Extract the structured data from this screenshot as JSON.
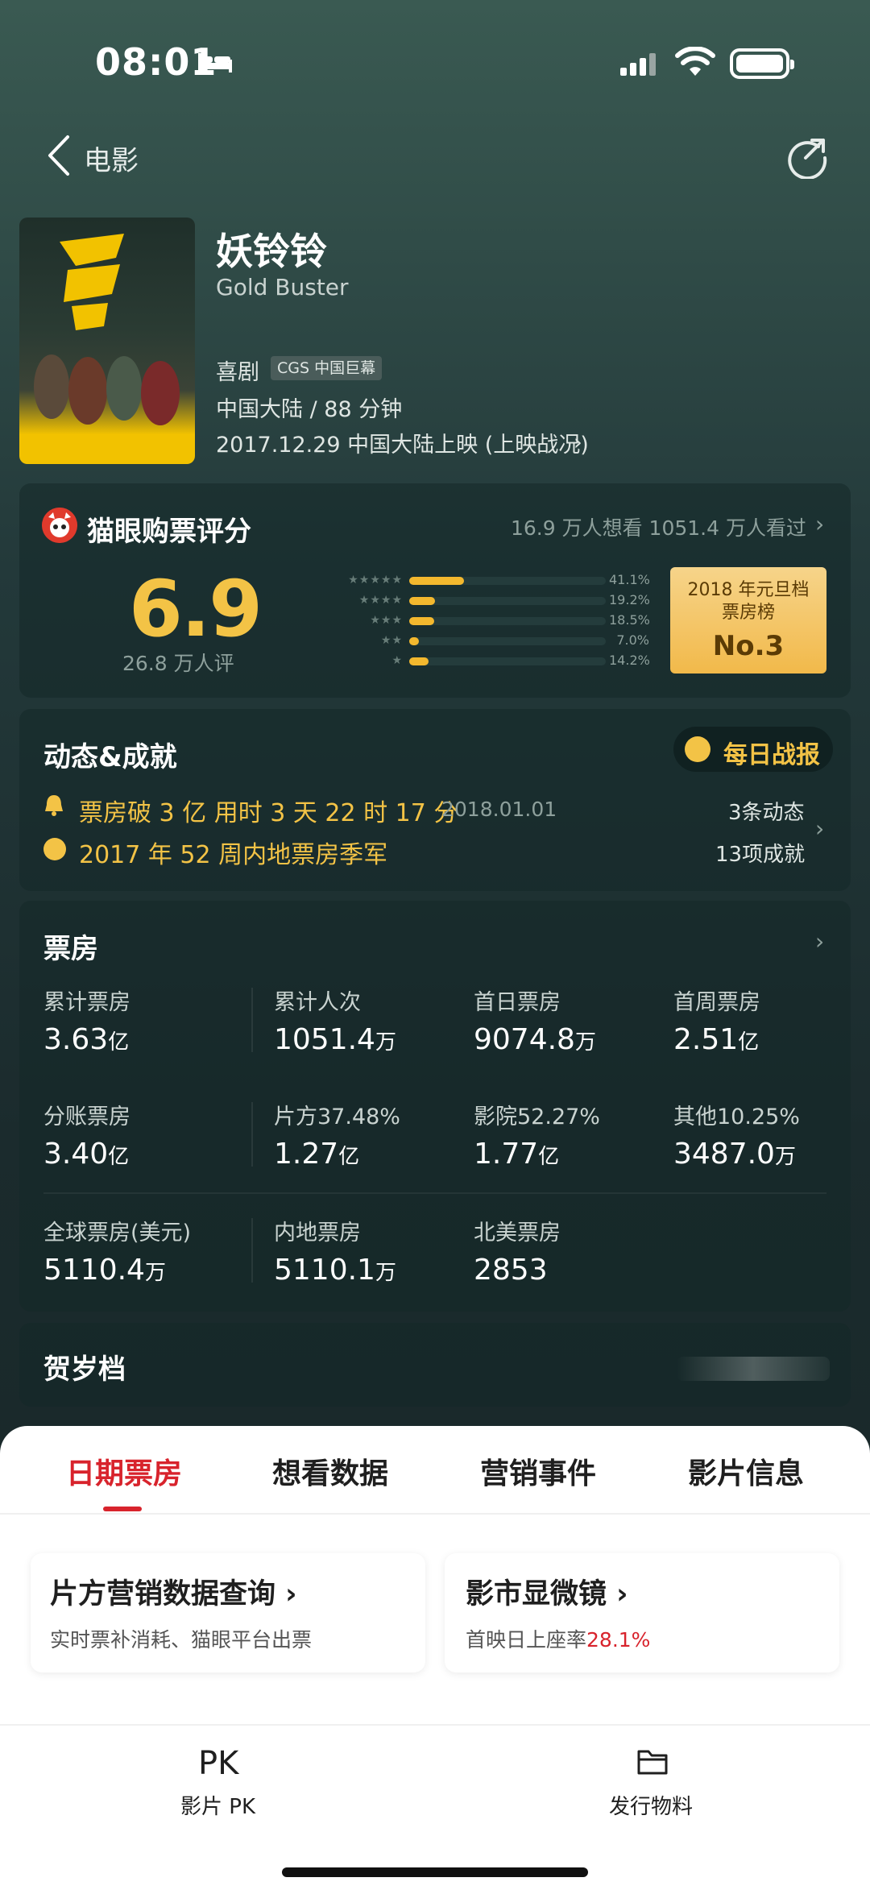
{
  "status_bar": {
    "time": "08:01"
  },
  "nav": {
    "title": "电影"
  },
  "movie": {
    "title": "妖铃铃",
    "title_en": "Gold Buster",
    "genre": "喜剧",
    "badge": "CGS 中国巨幕",
    "meta": "中国大陆 / 88 分钟",
    "release": "2017.12.29 中国大陆上映 (上映战况)"
  },
  "rating": {
    "title": "猫眼购票评分",
    "stats": "16.9 万人想看  1051.4 万人看过",
    "score": "6.9",
    "count": "26.8 万人评",
    "distribution": [
      {
        "stars": "★★★★★",
        "pct_label": "41.1%",
        "pct": 41.1
      },
      {
        "stars": "★★★★",
        "pct_label": "19.2%",
        "pct": 19.2
      },
      {
        "stars": "★★★",
        "pct_label": "18.5%",
        "pct": 18.5
      },
      {
        "stars": "★★",
        "pct_label": "7.0%",
        "pct": 7.0
      },
      {
        "stars": "★",
        "pct_label": "14.2%",
        "pct": 14.2
      }
    ],
    "rank": {
      "line1": "2018 年元旦档",
      "line2": "票房榜",
      "line3": "No.3"
    }
  },
  "dynamics": {
    "title": "动态&成就",
    "daily_button": "每日战报",
    "item1": "票房破 3 亿 用时 3 天 22 时 17 分",
    "item1_date": "2018.01.01",
    "item2": "2017 年 52 周内地票房季军",
    "count1": "3条动态",
    "count2": "13项成就"
  },
  "boxoffice": {
    "title": "票房",
    "cells": [
      {
        "label": "累计票房",
        "value": "3.63",
        "unit": "亿"
      },
      {
        "label": "累计人次",
        "value": "1051.4",
        "unit": "万"
      },
      {
        "label": "首日票房",
        "value": "9074.8",
        "unit": "万"
      },
      {
        "label": "首周票房",
        "value": "2.51",
        "unit": "亿"
      },
      {
        "label": "分账票房",
        "value": "3.40",
        "unit": "亿"
      },
      {
        "label": "片方37.48%",
        "value": "1.27",
        "unit": "亿"
      },
      {
        "label": "影院52.27%",
        "value": "1.77",
        "unit": "亿"
      },
      {
        "label": "其他10.25%",
        "value": "3487.0",
        "unit": "万"
      },
      {
        "label": "全球票房(美元)",
        "value": "5110.4",
        "unit": "万"
      },
      {
        "label": "内地票房",
        "value": "5110.1",
        "unit": "万"
      },
      {
        "label": "北美票房",
        "value": "2853",
        "unit": ""
      }
    ]
  },
  "holiday": {
    "title": "贺岁档"
  },
  "tabs": [
    "日期票房",
    "想看数据",
    "营销事件",
    "影片信息"
  ],
  "cards": {
    "card1": {
      "title": "片方营销数据查询 ›",
      "sub": "实时票补消耗、猫眼平台出票"
    },
    "card2": {
      "title": "影市显微镜 ›",
      "sub_prefix": "首映日上座率",
      "sub_value": "28.1%"
    }
  },
  "bottom": {
    "pk_icon": "PK",
    "pk_label": "影片 PK",
    "folder_label": "发行物料"
  },
  "colors": {
    "accent_red": "#d8232c",
    "gold": "#f3c346"
  }
}
